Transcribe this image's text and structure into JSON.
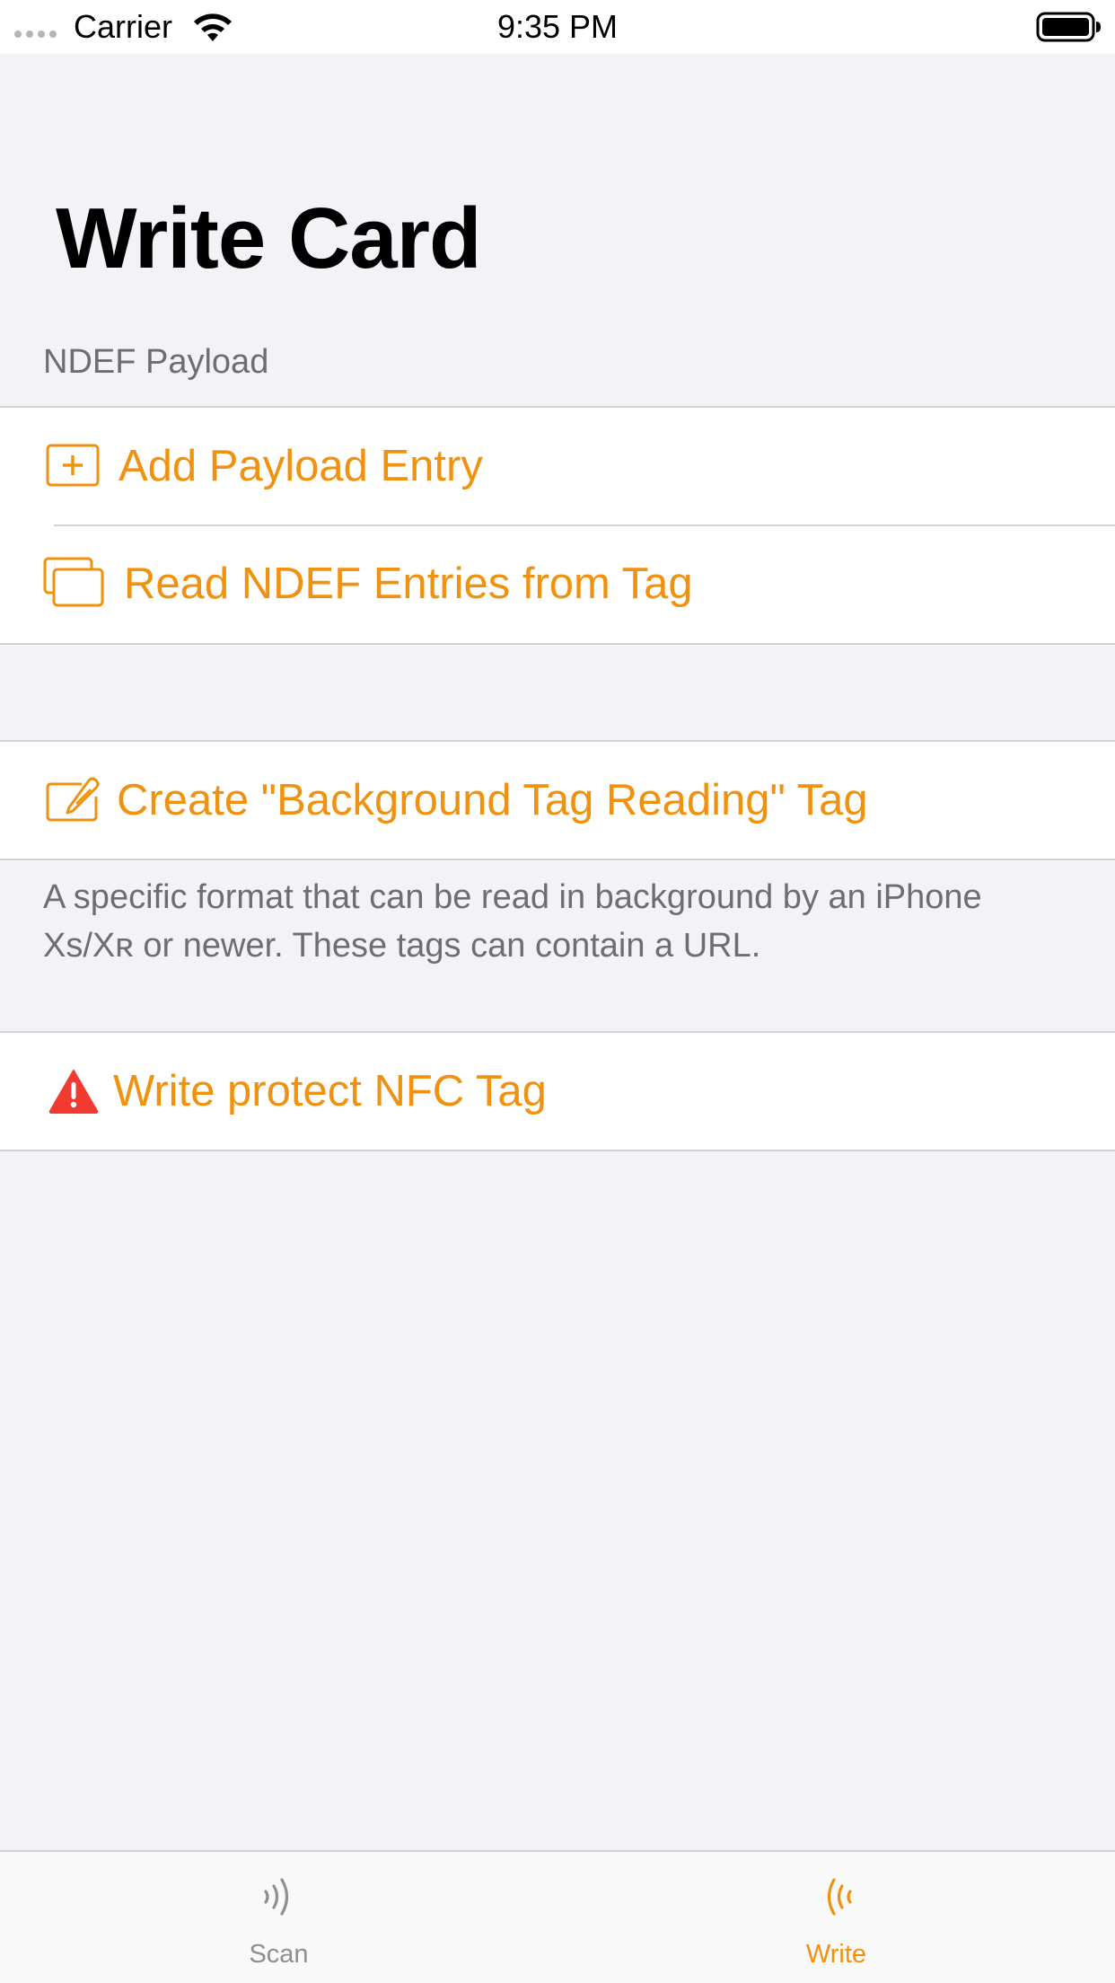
{
  "status_bar": {
    "carrier": "Carrier",
    "time": "9:35 PM"
  },
  "page": {
    "title": "Write Card"
  },
  "ndef_section": {
    "header": "NDEF Payload",
    "items": [
      {
        "label": "Add Payload Entry",
        "icon": "plus-square-icon"
      },
      {
        "label": "Read NDEF Entries from Tag",
        "icon": "stacked-cards-icon"
      }
    ]
  },
  "background_section": {
    "items": [
      {
        "label": "Create \"Background Tag Reading\" Tag",
        "icon": "compose-icon"
      }
    ],
    "footer": "A specific format that can be read in background by an iPhone Xs/Xʀ or newer. These tags can contain a URL."
  },
  "protect_section": {
    "items": [
      {
        "label": "Write protect NFC Tag",
        "icon": "warning-triangle-icon"
      }
    ]
  },
  "tab_bar": {
    "tabs": [
      {
        "label": "Scan",
        "icon": "nfc-scan-icon",
        "selected": false
      },
      {
        "label": "Write",
        "icon": "nfc-write-icon",
        "selected": true
      }
    ]
  },
  "colors": {
    "accent": "#f0920f",
    "background": "#f2f2f7",
    "secondary_text": "#6d6d72",
    "warning": "#f23b30",
    "inactive_tab": "#8e8e93"
  }
}
